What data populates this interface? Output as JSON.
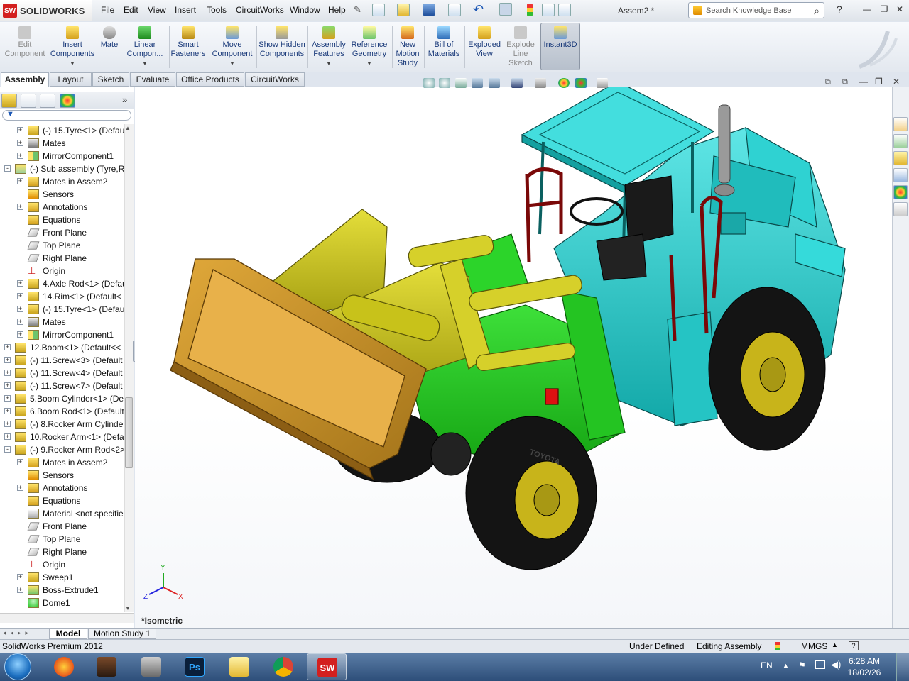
{
  "app": {
    "brand": "SOLIDWORKS",
    "document_title": "Assem2 *"
  },
  "menu": [
    "File",
    "Edit",
    "View",
    "Insert",
    "Tools",
    "CircuitWorks",
    "Window",
    "Help"
  ],
  "search": {
    "placeholder": "Search Knowledge Base"
  },
  "command_manager": [
    {
      "label": "Edit Component",
      "enabled": false
    },
    {
      "label": "Insert Components",
      "enabled": true
    },
    {
      "label": "Mate",
      "enabled": true
    },
    {
      "label": "Linear Compon...",
      "enabled": true
    },
    {
      "label": "Smart Fasteners",
      "enabled": true
    },
    {
      "label": "Move Component",
      "enabled": true
    },
    {
      "label": "Show Hidden Components",
      "enabled": true
    },
    {
      "label": "Assembly Features",
      "enabled": true
    },
    {
      "label": "Reference Geometry",
      "enabled": true
    },
    {
      "label": "New Motion Study",
      "enabled": true
    },
    {
      "label": "Bill of Materials",
      "enabled": true
    },
    {
      "label": "Exploded View",
      "enabled": true
    },
    {
      "label": "Explode Line Sketch",
      "enabled": false
    },
    {
      "label": "Instant3D",
      "enabled": true,
      "active": true
    }
  ],
  "tabs": [
    "Assembly",
    "Layout",
    "Sketch",
    "Evaluate",
    "Office Products",
    "CircuitWorks"
  ],
  "active_tab": "Assembly",
  "tree": [
    {
      "level": 2,
      "label": "(-) 15.Tyre<1> (Defau",
      "icon": "part",
      "expander": "+"
    },
    {
      "level": 2,
      "label": "Mates",
      "icon": "mates",
      "expander": "+"
    },
    {
      "level": 2,
      "label": "MirrorComponent1",
      "icon": "mirror",
      "expander": "+"
    },
    {
      "level": 1,
      "label": "(-) Sub assembly (Tyre,Ri",
      "icon": "assembly",
      "expander": "-"
    },
    {
      "level": 2,
      "label": "Mates in Assem2",
      "icon": "mates-folder",
      "expander": "+"
    },
    {
      "level": 2,
      "label": "Sensors",
      "icon": "sensors",
      "expander": ""
    },
    {
      "level": 2,
      "label": "Annotations",
      "icon": "annotations",
      "expander": "+"
    },
    {
      "level": 2,
      "label": "Equations",
      "icon": "equations",
      "expander": ""
    },
    {
      "level": 2,
      "label": "Front Plane",
      "icon": "plane",
      "expander": ""
    },
    {
      "level": 2,
      "label": "Top Plane",
      "icon": "plane",
      "expander": ""
    },
    {
      "level": 2,
      "label": "Right Plane",
      "icon": "plane",
      "expander": ""
    },
    {
      "level": 2,
      "label": "Origin",
      "icon": "origin",
      "expander": ""
    },
    {
      "level": 2,
      "label": "4.Axle Rod<1> (Defau",
      "icon": "part",
      "expander": "+"
    },
    {
      "level": 2,
      "label": "14.Rim<1> (Default<",
      "icon": "part",
      "expander": "+"
    },
    {
      "level": 2,
      "label": "(-) 15.Tyre<1> (Defau",
      "icon": "part",
      "expander": "+"
    },
    {
      "level": 2,
      "label": "Mates",
      "icon": "mates",
      "expander": "+"
    },
    {
      "level": 2,
      "label": "MirrorComponent1",
      "icon": "mirror",
      "expander": "+"
    },
    {
      "level": 1,
      "label": "12.Boom<1> (Default<<",
      "icon": "part",
      "expander": "+"
    },
    {
      "level": 1,
      "label": "(-) 11.Screw<3> (Default",
      "icon": "part",
      "expander": "+"
    },
    {
      "level": 1,
      "label": "(-) 11.Screw<4> (Default",
      "icon": "part",
      "expander": "+"
    },
    {
      "level": 1,
      "label": "(-) 11.Screw<7> (Default",
      "icon": "part",
      "expander": "+"
    },
    {
      "level": 1,
      "label": "5.Boom Cylinder<1> (De",
      "icon": "part",
      "expander": "+"
    },
    {
      "level": 1,
      "label": "6.Boom Rod<1> (Default",
      "icon": "part",
      "expander": "+"
    },
    {
      "level": 1,
      "label": "(-) 8.Rocker Arm Cylinde",
      "icon": "part",
      "expander": "+"
    },
    {
      "level": 1,
      "label": "10.Rocker Arm<1> (Defa",
      "icon": "part",
      "expander": "+"
    },
    {
      "level": 1,
      "label": "(-) 9.Rocker Arm Rod<2>",
      "icon": "part",
      "expander": "-"
    },
    {
      "level": 2,
      "label": "Mates in Assem2",
      "icon": "mates-folder",
      "expander": "+"
    },
    {
      "level": 2,
      "label": "Sensors",
      "icon": "sensors",
      "expander": ""
    },
    {
      "level": 2,
      "label": "Annotations",
      "icon": "annotations",
      "expander": "+"
    },
    {
      "level": 2,
      "label": "Equations",
      "icon": "equations",
      "expander": ""
    },
    {
      "level": 2,
      "label": "Material <not specifie",
      "icon": "material",
      "expander": ""
    },
    {
      "level": 2,
      "label": "Front Plane",
      "icon": "plane",
      "expander": ""
    },
    {
      "level": 2,
      "label": "Top Plane",
      "icon": "plane",
      "expander": ""
    },
    {
      "level": 2,
      "label": "Right Plane",
      "icon": "plane",
      "expander": ""
    },
    {
      "level": 2,
      "label": "Origin",
      "icon": "origin",
      "expander": ""
    },
    {
      "level": 2,
      "label": "Sweep1",
      "icon": "sweep",
      "expander": "+"
    },
    {
      "level": 2,
      "label": "Boss-Extrude1",
      "icon": "extrude",
      "expander": "+"
    },
    {
      "level": 2,
      "label": "Dome1",
      "icon": "dome",
      "expander": ""
    }
  ],
  "viewport": {
    "view_label": "*Isometric",
    "triad": [
      "Y",
      "X",
      "Z"
    ],
    "tyre_brand": "TOYOTA"
  },
  "bottom_tabs": [
    "Model",
    "Motion Study 1"
  ],
  "status": {
    "product": "SolidWorks Premium 2012",
    "state": "Under Defined",
    "mode": "Editing Assembly",
    "units": "MMGS"
  },
  "taskbar": {
    "apps": [
      "firefox",
      "game",
      "counter-strike",
      "photoshop",
      "explorer",
      "chrome",
      "solidworks"
    ],
    "language": "EN",
    "time": "6:28 AM",
    "date": "18/02/26"
  },
  "colors": {
    "chassis": "#1fc8c8",
    "loader_arm": "#c8c21a",
    "bucket": "#c8901e",
    "body_green": "#1ec81a",
    "tyre": "#141414",
    "rim": "#c8b41a",
    "rails": "#8b0a0a"
  }
}
